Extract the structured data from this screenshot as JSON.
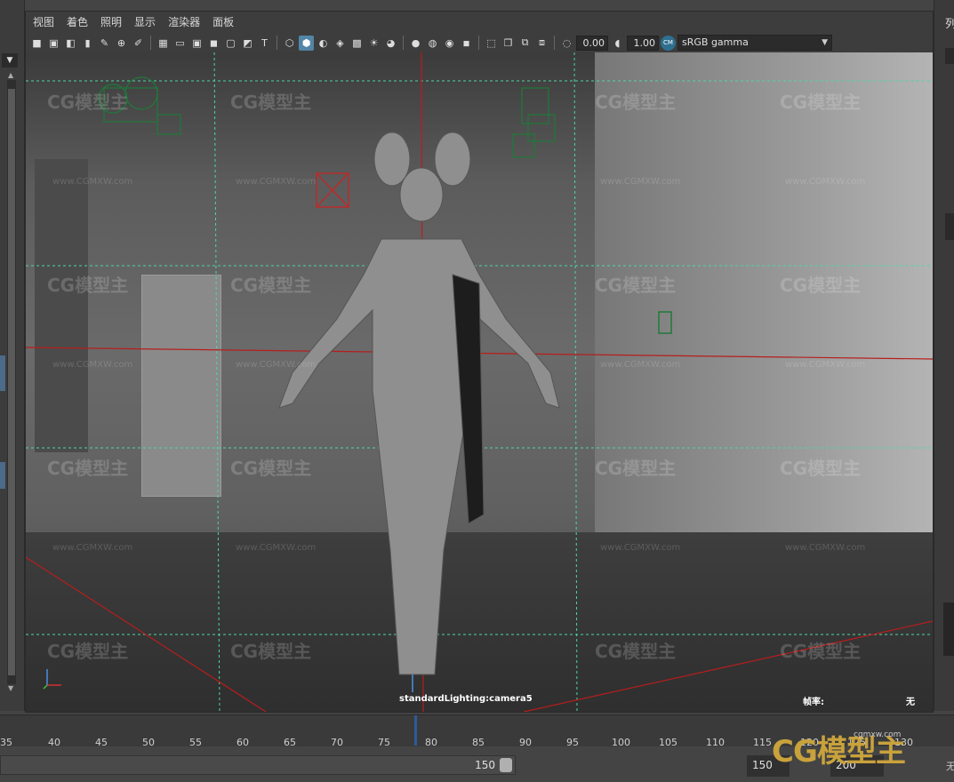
{
  "menu": [
    "视图",
    "着色",
    "照明",
    "显示",
    "渲染器",
    "面板"
  ],
  "toolbar": {
    "exposure": "0.00",
    "gamma": "1.00",
    "color_space": "sRGB gamma",
    "cm_badge": "CM"
  },
  "viewport": {
    "camera_name": "standardLighting:camera5",
    "frame_label": "帧率:",
    "frame_value": "无"
  },
  "watermark": {
    "brand": "CG模型主",
    "url": "www.CGMXW.com"
  },
  "timeline": {
    "ticks": [
      "35",
      "40",
      "45",
      "50",
      "55",
      "60",
      "65",
      "70",
      "75",
      "80",
      "85",
      "90",
      "95",
      "100",
      "105",
      "110",
      "115",
      "120",
      "125",
      "130"
    ]
  },
  "range": {
    "slider_value": "150",
    "end_value": "150",
    "total_value": "200",
    "tail_text": "无"
  },
  "right_panel": {
    "label": "列"
  },
  "logo": {
    "text": "CG模型主",
    "url": "cgmxw.com"
  },
  "colors": {
    "accent": "#5285a6",
    "grid_red": "#b81d1d",
    "grid_green": "#4fd6a4",
    "camera_green": "#1f7a3a"
  }
}
